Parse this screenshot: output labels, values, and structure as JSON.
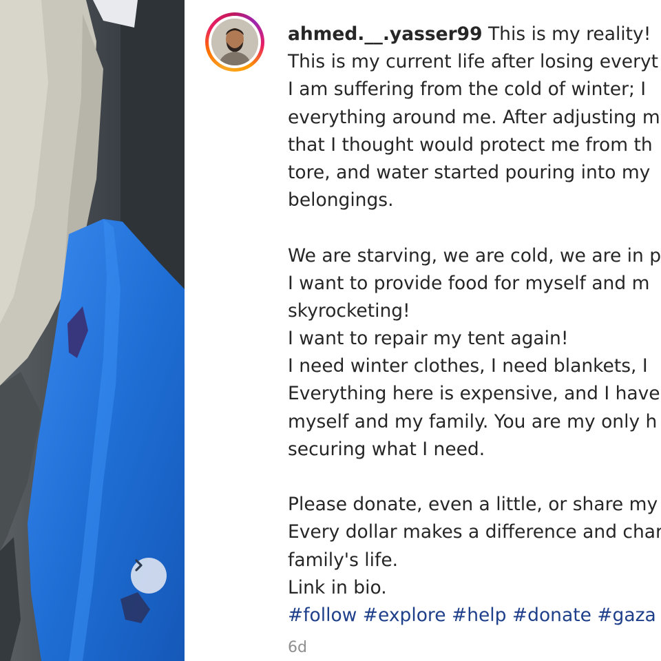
{
  "post": {
    "username": "ahmed.__.yasser99",
    "caption_lines": [
      "This is my reality!",
      "This is my current life after losing everyt",
      "I am suffering from the cold of winter; I",
      "everything around me. After adjusting m",
      "that I thought would protect me from th",
      "tore, and water started pouring into my",
      "belongings.",
      "",
      "We are starving, we are cold, we are in p",
      "I want to provide food for myself and m",
      "skyrocketing!",
      "I want to repair my tent again!",
      "I need winter clothes, I need blankets, I",
      "Everything here is expensive, and I have",
      "myself and my family. You are my only h",
      "securing what I need.",
      "",
      "Please donate, even a little, or share my",
      "Every dollar makes a difference and char",
      "family's life.",
      "Link in bio."
    ],
    "hashtags": [
      "#follow",
      "#explore",
      "#help",
      "#donate",
      "#gaza",
      "#"
    ],
    "timestamp": "6d"
  },
  "media": {
    "next_icon": "chevron-right-icon"
  },
  "colors": {
    "hashtag": "#1e3f8a",
    "text": "#262626",
    "timestamp": "#8e8e8e",
    "bag_blue": "#1f6fd6"
  }
}
